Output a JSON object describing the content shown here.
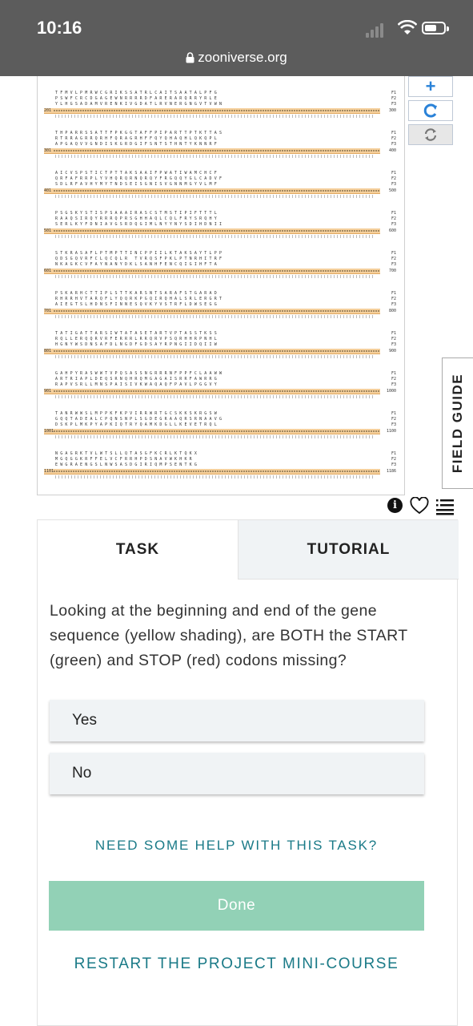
{
  "status_bar": {
    "time": "10:16"
  },
  "browser": {
    "url": "zooniverse.org"
  },
  "subject": {
    "blocks": [
      {
        "pos": "201",
        "end": "300",
        "aa": [
          "TFMVLPMRWCGRIKSSATRLCAITSAATALPFG",
          "PSWFCRCDGAGEWNRRRRDFARERARQRRYRLE",
          "YLHGSADAMVRENKIVGDATLRVNERGNGVTVWN"
        ],
        "stops": []
      },
      {
        "pos": "301",
        "end": "400",
        "aa": [
          "THPARRSSATTFPKGGTAFFPIPARTTPTKTTAS",
          "RTRRAGRRQRHFQRAGRHFFQYQHAQHLQKQPL",
          "APGAQVVGNDISKGRDGIFSNTSTHNTYKNNRF"
        ],
        "stops": []
      },
      {
        "pos": "401",
        "end": "500",
        "aa": [
          "AICVSPSTICTPTTAKSAAIFPWATIWAMCHCF",
          "QRFAFRRPLYVHQRQRNQRQYFRGQQYGLCADVF",
          "SDLRFAVHYMYTNDSEISGNISVGNNMGYVLMF"
        ],
        "stops": []
      },
      {
        "pos": "501",
        "end": "600",
        "aa": [
          "PSGSKYSTISPSAAAIRASCSTMSTIPIFTTTL",
          "RAAQSIRQYRRRQPRSGHHAQLCQLFRYSRQHY",
          "SERLKYFDNIAVGSRDQGIMLNYYNYSDIHDNII"
        ],
        "stops": []
      },
      {
        "pos": "601",
        "end": "700",
        "aa": [
          "STKRASAFLPTMPTTINCPPIILKTAKSAYTLPP",
          "QDSGQVRFCLQCQLR#TVRQSFPKLPTNRHITRF",
          "NKAGKCVFAYNANYDKLSANHFENCQIGIHFTA"
        ],
        "stops": []
      },
      {
        "pos": "701",
        "end": "800",
        "aa": [
          "PSKARHCTTIPLSTTKARSNTSARAFSTGARAD",
          "RHRRHVTARQFLYQQRKPGQIRQHALSRLERGRT",
          "AIEGTSLHDNSFINNESQVKYVSTRFLDWSEGG"
        ],
        "stops": []
      },
      {
        "pos": "801",
        "end": "900",
        "aa": [
          "TATIGATTARSIWTATASETARTVPTASSTKSS",
          "RQLLERQQRVRFERRRLRRQRVPSQRHHRPNHL",
          "HGNYWSDNSAFDLNGDFGDSAYRPNGIIDQIIW"
        ],
        "stops": []
      },
      {
        "pos": "901",
        "end": "1000",
        "aa": [
          "GAHPYRASWWTVPQSASSNGRRRNFPPFCLAAWW",
          "ARTRIAPLDEQSRNQHRQMGAGAISRRFAWRRG",
          "RAPVSRLLMNSPAISIVKWAQAQFPAVLPGGVY"
        ],
        "stops": []
      },
      {
        "pos": "1001",
        "end": "1100",
        "aa": [
          "TANRWWSLMPPKFKPVIRRWRTGCSKKSKRGSW",
          "GQQTADEALCPQNSNPLSGDEGRAAQRSRNAAVG",
          "DSKPLMKPYAPKIQTRYQAMKDGLLKEVETRQL"
        ],
        "stops": []
      },
      {
        "pos": "1101",
        "end": "1186",
        "aa": [
          "NGAGRKTVLWTSLLQTASGFKCRLKTQKX",
          "MGQGGKRFFELVCFRRHPDSNAVWKHKR",
          "EWGRAENGSLNWSASDGIRIQMPSENTKG"
        ],
        "stops": []
      }
    ]
  },
  "toolbar": {
    "zoom_in_icon": "plus-icon",
    "reset_icon": "refresh-icon",
    "rotate_icon": "rotate-icon"
  },
  "field_guide": {
    "label": "FIELD GUIDE"
  },
  "task_panel": {
    "tabs": [
      {
        "label": "TASK"
      },
      {
        "label": "TUTORIAL"
      }
    ],
    "question": "Looking at the beginning and end of the gene sequence (yellow shading), are BOTH the START (green) and STOP (red) codons missing?",
    "answers": [
      {
        "label": "Yes"
      },
      {
        "label": "No"
      }
    ],
    "help_link": "NEED SOME HELP WITH THIS TASK?",
    "done_label": "Done",
    "restart_link": "RESTART THE PROJECT MINI-COURSE"
  },
  "colors": {
    "teal": "#1a7a87",
    "done_green": "#92d1b6",
    "sequence_highlight": "#f5cf9b",
    "stop_red": "#e74c3c"
  }
}
